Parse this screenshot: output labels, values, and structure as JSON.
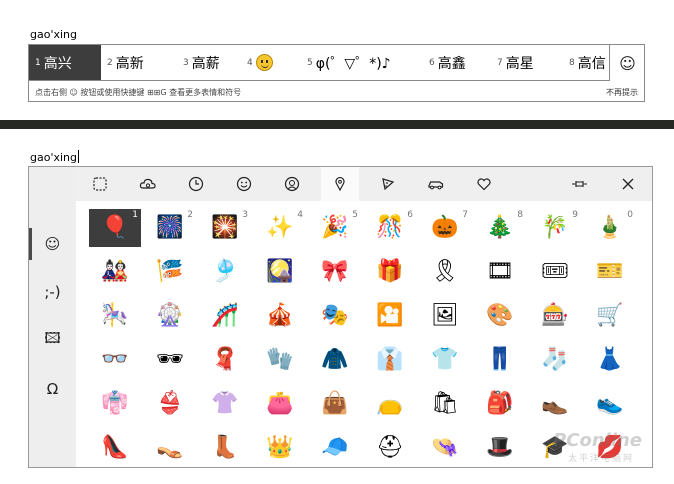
{
  "top_input": {
    "text": "gao'xing"
  },
  "candidates": [
    {
      "num": "1",
      "text": "高兴",
      "selected": true
    },
    {
      "num": "2",
      "text": "高新"
    },
    {
      "num": "3",
      "text": "高薪"
    },
    {
      "num": "4",
      "text": "",
      "is_emoji": true
    },
    {
      "num": "5",
      "text": "φ(゜▽゜*)♪"
    },
    {
      "num": "6",
      "text": "高鑫"
    },
    {
      "num": "7",
      "text": "高星"
    },
    {
      "num": "8",
      "text": "高信"
    }
  ],
  "emoji_button_glyph": "☺",
  "hint_left": "点击右侧 ☺ 按钮或使用快捷键 ⊞⊞G 查看更多表情和符号",
  "hint_right": "不再提示",
  "bottom_input": {
    "text": "gao'xing"
  },
  "sidebar": [
    {
      "name": "emoji",
      "glyph": "☺",
      "active": true
    },
    {
      "name": "kaomoji",
      "glyph": ";-)"
    },
    {
      "name": "image",
      "glyph": "🖾"
    },
    {
      "name": "symbols",
      "glyph": "Ω"
    }
  ],
  "toolbar_icons": [
    "recent-frame",
    "weather-cloud",
    "clock",
    "smiley",
    "person",
    "location-pin",
    "pizza",
    "car",
    "heart",
    "pin",
    "close"
  ],
  "grid_rows": [
    [
      {
        "e": "🎈",
        "k": "1"
      },
      {
        "e": "🎆",
        "k": "2"
      },
      {
        "e": "🎇",
        "k": "3"
      },
      {
        "e": "✨",
        "k": "4"
      },
      {
        "e": "🎉",
        "k": "5"
      },
      {
        "e": "🎊",
        "k": "6"
      },
      {
        "e": "🎃",
        "k": "7"
      },
      {
        "e": "🎄",
        "k": "8"
      },
      {
        "e": "🎋",
        "k": "9"
      },
      {
        "e": "🎍",
        "k": "0"
      }
    ],
    [
      {
        "e": "🎎"
      },
      {
        "e": "🎏"
      },
      {
        "e": "🎐"
      },
      {
        "e": "🎑"
      },
      {
        "e": "🎀"
      },
      {
        "e": "🎁"
      },
      {
        "e": "🎗"
      },
      {
        "e": "🎞"
      },
      {
        "e": "🎟"
      },
      {
        "e": "🎫"
      }
    ],
    [
      {
        "e": "🎠"
      },
      {
        "e": "🎡"
      },
      {
        "e": "🎢"
      },
      {
        "e": "🎪"
      },
      {
        "e": "🎭"
      },
      {
        "e": "🎦"
      },
      {
        "e": "🖼"
      },
      {
        "e": "🎨"
      },
      {
        "e": "🎰"
      },
      {
        "e": "🛒"
      }
    ],
    [
      {
        "e": "👓"
      },
      {
        "e": "🕶"
      },
      {
        "e": "🧣"
      },
      {
        "e": "🧤"
      },
      {
        "e": "🧥"
      },
      {
        "e": "👔"
      },
      {
        "e": "👕"
      },
      {
        "e": "👖"
      },
      {
        "e": "🧦"
      },
      {
        "e": "👗"
      }
    ],
    [
      {
        "e": "👘"
      },
      {
        "e": "👙"
      },
      {
        "e": "👚"
      },
      {
        "e": "👛"
      },
      {
        "e": "👜"
      },
      {
        "e": "👝"
      },
      {
        "e": "🛍"
      },
      {
        "e": "🎒"
      },
      {
        "e": "👞"
      },
      {
        "e": "👟"
      }
    ],
    [
      {
        "e": "👠"
      },
      {
        "e": "👡"
      },
      {
        "e": "👢"
      },
      {
        "e": "👑"
      },
      {
        "e": "🧢"
      },
      {
        "e": "⛑"
      },
      {
        "e": "👒"
      },
      {
        "e": "🎩"
      },
      {
        "e": "🎓"
      },
      {
        "e": "💋"
      }
    ]
  ],
  "watermark": "PConline",
  "watermark_sub": "太平洋电脑网"
}
